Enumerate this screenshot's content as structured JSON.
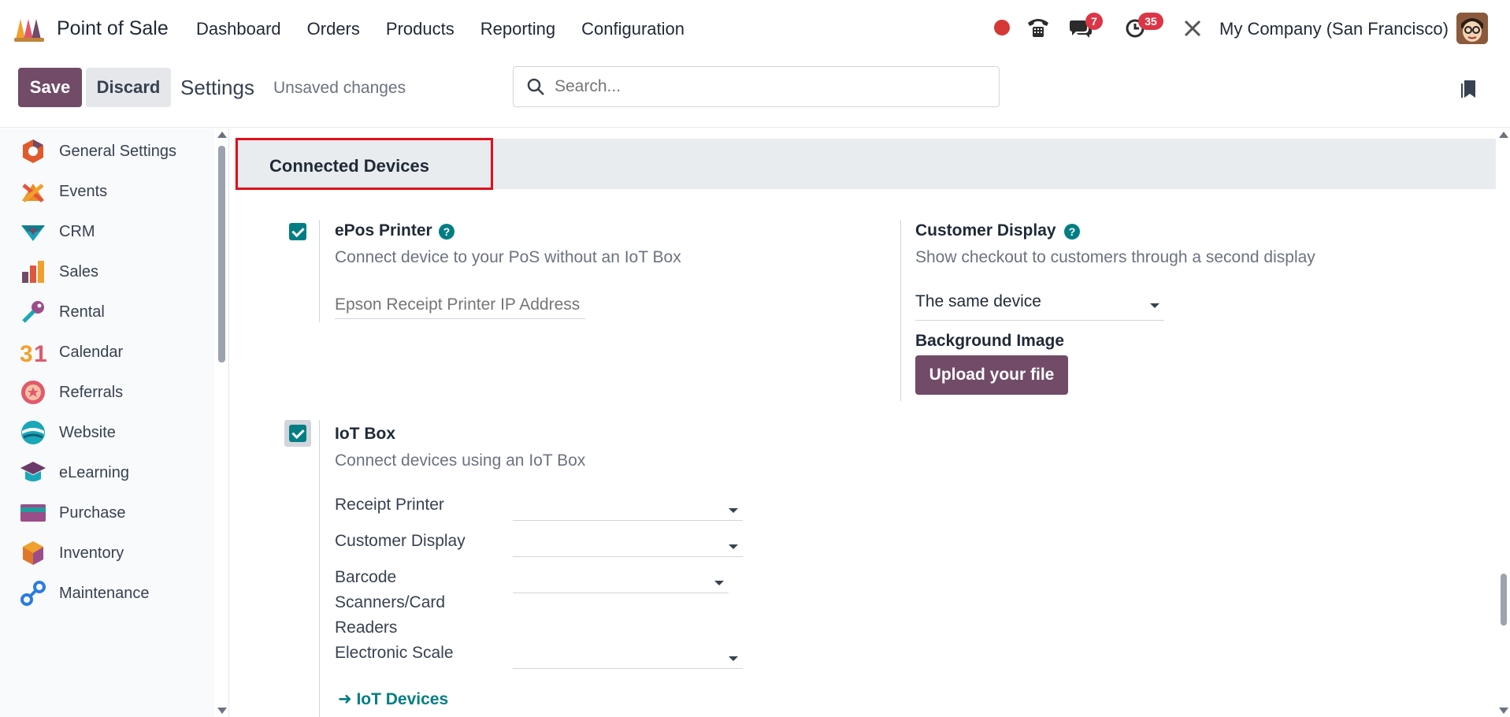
{
  "navbar": {
    "app_name": "Point of Sale",
    "menu": [
      "Dashboard",
      "Orders",
      "Products",
      "Reporting",
      "Configuration"
    ],
    "messages_badge": "7",
    "activities_badge": "35",
    "company": "My Company (San Francisco)"
  },
  "control": {
    "save_label": "Save",
    "discard_label": "Discard",
    "breadcrumb": "Settings",
    "status": "Unsaved changes",
    "search_placeholder": "Search..."
  },
  "sidebar": {
    "items": [
      {
        "label": "General Settings",
        "icon": "general-settings-icon",
        "color": "#e05a2b"
      },
      {
        "label": "Events",
        "icon": "events-icon",
        "color": "#f08a24"
      },
      {
        "label": "CRM",
        "icon": "crm-icon",
        "color": "#17a2b8"
      },
      {
        "label": "Sales",
        "icon": "sales-icon",
        "color": "#e0563b"
      },
      {
        "label": "Rental",
        "icon": "rental-icon",
        "color": "#9b4d8a"
      },
      {
        "label": "Calendar",
        "icon": "calendar-icon",
        "color": "#f0a12b"
      },
      {
        "label": "Referrals",
        "icon": "referrals-icon",
        "color": "#e05a6b"
      },
      {
        "label": "Website",
        "icon": "website-icon",
        "color": "#1aa7b8"
      },
      {
        "label": "eLearning",
        "icon": "elearning-icon",
        "color": "#6b3a6b"
      },
      {
        "label": "Purchase",
        "icon": "purchase-icon",
        "color": "#1f9e9e"
      },
      {
        "label": "Inventory",
        "icon": "inventory-icon",
        "color": "#e0762b"
      },
      {
        "label": "Maintenance",
        "icon": "maintenance-icon",
        "color": "#2b7be0"
      }
    ]
  },
  "section": {
    "title": "Connected Devices"
  },
  "epos": {
    "title": "ePos Printer",
    "desc": "Connect device to your PoS without an IoT Box",
    "ip_placeholder": "Epson Receipt Printer IP Address"
  },
  "customer_display": {
    "title": "Customer Display",
    "desc": "Show checkout to customers through a second display",
    "selected": "The same device",
    "bg_label": "Background Image",
    "upload_label": "Upload your file"
  },
  "iot": {
    "title": "IoT Box",
    "desc": "Connect devices using an IoT Box",
    "fields": [
      "Receipt Printer",
      "Customer Display",
      "Barcode Scanners/Card Readers",
      "Electronic Scale"
    ],
    "link": "IoT Devices"
  }
}
